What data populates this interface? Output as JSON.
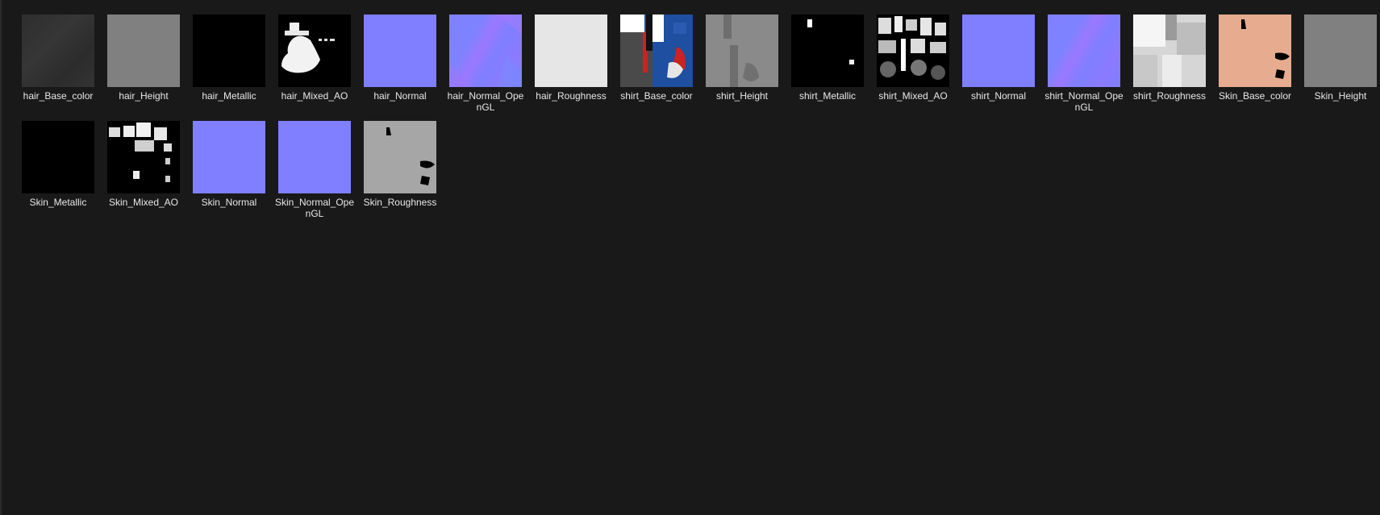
{
  "files": [
    {
      "label": "hair_Base_color",
      "thumb": "dark-grey"
    },
    {
      "label": "hair_Height",
      "thumb": "grey"
    },
    {
      "label": "hair_Metallic",
      "thumb": "black"
    },
    {
      "label": "hair_Mixed_AO",
      "thumb": "ao-hair"
    },
    {
      "label": "hair_Normal",
      "thumb": "normal"
    },
    {
      "label": "hair_Normal_OpenGL",
      "thumb": "normal-var"
    },
    {
      "label": "hair_Roughness",
      "thumb": "light-grey"
    },
    {
      "label": "shirt_Base_color",
      "thumb": "shirt-color"
    },
    {
      "label": "shirt_Height",
      "thumb": "shirt-height"
    },
    {
      "label": "shirt_Metallic",
      "thumb": "shirt-metallic"
    },
    {
      "label": "shirt_Mixed_AO",
      "thumb": "ao-shirt"
    },
    {
      "label": "shirt_Normal",
      "thumb": "normal"
    },
    {
      "label": "shirt_Normal_OpenGL",
      "thumb": "normal-var"
    },
    {
      "label": "shirt_Roughness",
      "thumb": "shirt-rough"
    },
    {
      "label": "Skin_Base_color",
      "thumb": "skin"
    },
    {
      "label": "Skin_Height",
      "thumb": "grey"
    },
    {
      "label": "Skin_Metallic",
      "thumb": "black"
    },
    {
      "label": "Skin_Mixed_AO",
      "thumb": "ao-skin"
    },
    {
      "label": "Skin_Normal",
      "thumb": "normal"
    },
    {
      "label": "Skin_Normal_OpenGL",
      "thumb": "normal"
    },
    {
      "label": "Skin_Roughness",
      "thumb": "skin-rough"
    }
  ],
  "colors": {
    "background": "#191919",
    "normal_map": "#7f7fff",
    "skin": "#e7ab8f"
  }
}
